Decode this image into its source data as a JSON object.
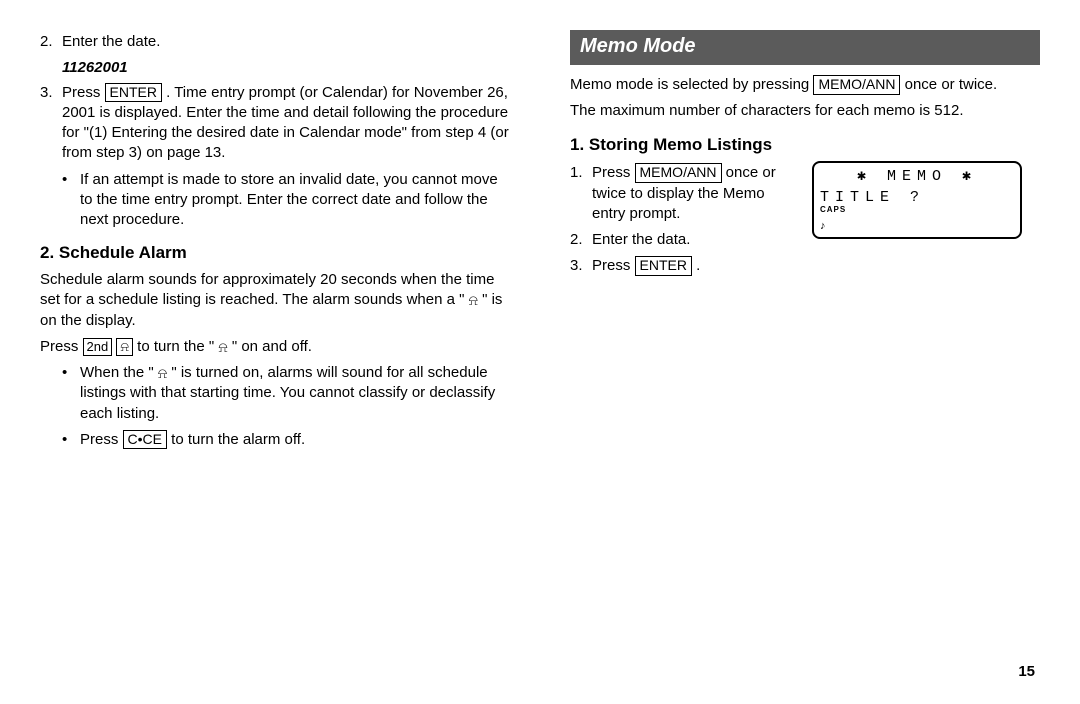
{
  "left": {
    "step2_num": "2.",
    "step2_text": "Enter the date.",
    "example_date": "11262001",
    "step3_num": "3.",
    "step3_pre": "Press ",
    "key_enter": "ENTER",
    "step3_post": " . Time entry prompt (or Calendar) for November 26, 2001 is displayed. Enter the time and detail following the procedure for \"(1) Entering the desired date in Calendar mode\" from step 4 (or from step 3) on page 13.",
    "bullet1": "If an attempt is made to store an invalid date, you cannot move to the time entry prompt. Enter the correct date and follow the next procedure.",
    "h2": "2. Schedule Alarm",
    "p1_pre": "Schedule alarm sounds for approximately 20 seconds when the time set for a schedule listing is reached. The alarm sounds when a \" ",
    "p1_post": " \" is on the display.",
    "press_pre": "Press ",
    "key_2nd": "2nd",
    "press_mid": " to turn the \" ",
    "press_post": " \" on and off.",
    "bullet2_pre": "When the \" ",
    "bullet2_post": " \" is turned on, alarms will sound for all schedule listings with that starting time. You cannot classify or declassify each listing.",
    "bullet3_pre": "Press ",
    "key_cce": "C•CE",
    "bullet3_post": " to turn the alarm off."
  },
  "right": {
    "banner": "Memo Mode",
    "p1_pre": "Memo mode is selected by pressing ",
    "key_memoann": "MEMO/ANN",
    "p1_post": " once or twice.",
    "p2": "The maximum number of characters for each memo is 512.",
    "h2": "1. Storing Memo Listings",
    "s1_num": "1.",
    "s1_pre": "Press ",
    "s1_post": " once or twice to display the Memo entry prompt.",
    "s2_num": "2.",
    "s2_text": "Enter the data.",
    "s3_num": "3.",
    "s3_pre": "Press ",
    "key_enter": "ENTER",
    "s3_post": " .",
    "lcd": {
      "line1": "✱ MEMO ✱",
      "line2": "TITLE ?",
      "caps": "CAPS",
      "note": "♪"
    }
  },
  "pagenum": "15",
  "glyph": {
    "bell": "⍾",
    "dot": "•"
  }
}
